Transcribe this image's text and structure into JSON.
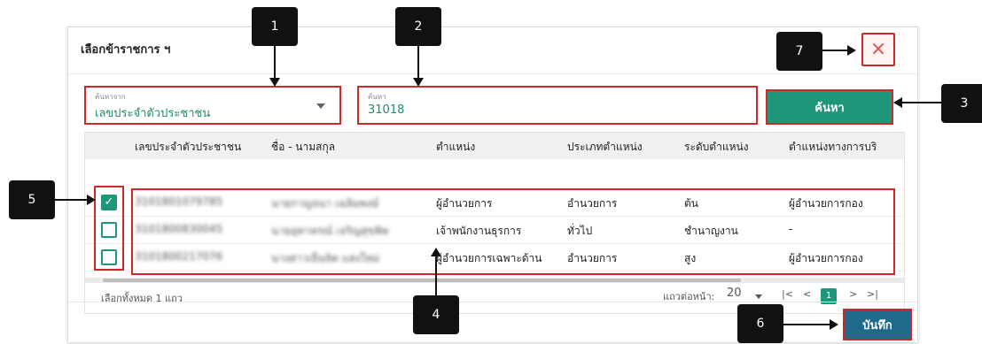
{
  "dialog": {
    "title": "เลือกข้าราชการ ฯ",
    "close_symbol": "×"
  },
  "search": {
    "source_label": "ค้นหาจาก",
    "source_value": "เลขประจำตัวประชาชน",
    "query_label": "ค้นหา",
    "query_value": "31018",
    "button_label": "ค้นหา"
  },
  "table": {
    "columns": [
      "เลขประจำตัวประชาชน",
      "ชื่อ - นามสกุล",
      "ตำแหน่ง",
      "ประเภทตำแหน่ง",
      "ระดับตำแหน่ง",
      "ตำแหน่งทางการบริ"
    ],
    "rows": [
      {
        "checked": true,
        "id": "3101801079785",
        "name": "นายกาญจนา เฉลิมพงษ์",
        "position": "ผู้อำนวยการ",
        "type": "อำนวยการ",
        "level": "ต้น",
        "admin_position": "ผู้อำนวยการกอง"
      },
      {
        "checked": false,
        "id": "3101800830045",
        "name": "นายอุทาหรณ์ เจริญสุขพิพ",
        "position": "เจ้าพนักงานธุรการ",
        "type": "ทั่วไป",
        "level": "ชำนาญงาน",
        "admin_position": "-"
      },
      {
        "checked": false,
        "id": "3101800217076",
        "name": "นางสาวเย็นจิต แสงใหม่",
        "position": "ผู้อำนวยการเฉพาะด้าน",
        "type": "อำนวยการ",
        "level": "สูง",
        "admin_position": "ผู้อำนวยการกอง"
      }
    ],
    "check_mark": "✓"
  },
  "footer": {
    "selected_text": "เลือกทั้งหมด 1 แถว",
    "rows_per_page_label": "แถวต่อหน้า:",
    "rows_per_page_value": "20",
    "first_symbol": "|<",
    "prev_symbol": "<",
    "current_page": "1",
    "next_symbol": ">",
    "last_symbol": ">|"
  },
  "actions": {
    "save_label": "บันทึก"
  },
  "callouts": [
    "1",
    "2",
    "3",
    "4",
    "5",
    "6",
    "7"
  ]
}
